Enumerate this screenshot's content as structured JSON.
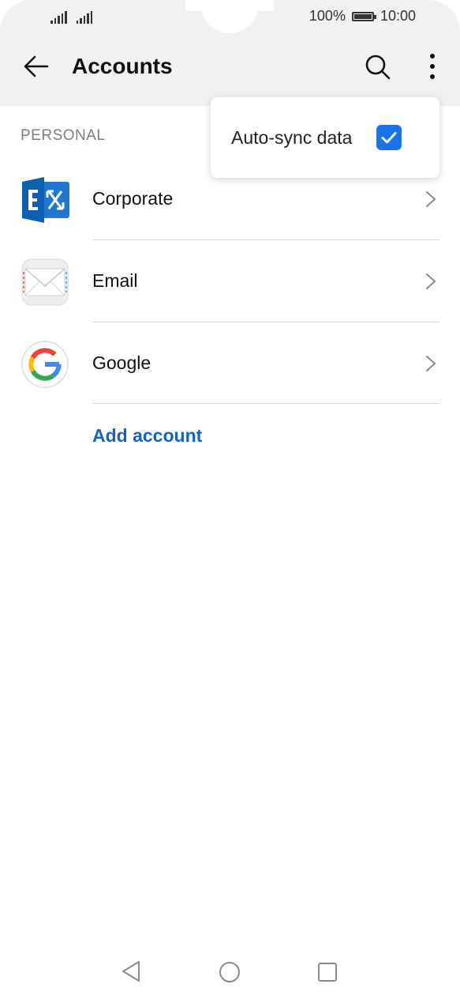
{
  "status_bar": {
    "battery_percent": "100%",
    "time": "10:00"
  },
  "app_bar": {
    "title": "Accounts",
    "back_icon": "arrow-left-icon",
    "search_icon": "search-icon",
    "more_icon": "more-vertical-icon"
  },
  "section": {
    "header": "PERSONAL"
  },
  "accounts": [
    {
      "label": "Corporate",
      "icon": "exchange-icon"
    },
    {
      "label": "Email",
      "icon": "envelope-icon"
    },
    {
      "label": "Google",
      "icon": "google-icon"
    }
  ],
  "add_account": {
    "label": "Add account"
  },
  "popup_menu": {
    "item_label": "Auto-sync data",
    "checked": true
  },
  "colors": {
    "accent": "#1a73e8",
    "link": "#1565c0",
    "exchange_blue": "#0f5fb0",
    "topbar_bg": "#f1f1f1"
  },
  "nav_bar": {
    "back_icon": "triangle-back-icon",
    "home_icon": "circle-home-icon",
    "recent_icon": "square-recent-icon"
  }
}
